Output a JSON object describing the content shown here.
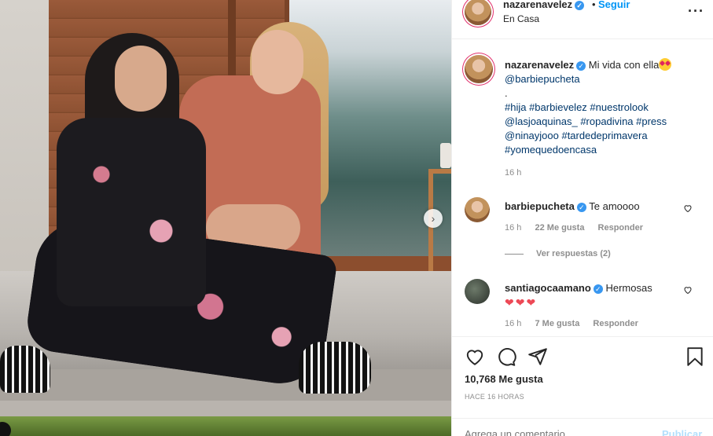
{
  "post": {
    "username": "nazarenavelez",
    "verified": true,
    "follow_label": "Seguir",
    "separator": "•",
    "location": "En Casa",
    "more_icon": "more-options-icon"
  },
  "caption": {
    "username": "nazarenavelez",
    "text": "Mi vida con ella",
    "mention": "@barbiepucheta",
    "dot": ".",
    "tags_line1": "#hija #barbievelez #nuestrolook",
    "tags_line2": "@lasjoaquinas_ #ropadivina #press",
    "tags_line3": "@ninayjooo #tardedeprimavera",
    "tags_line4": "#yomequedoencasa",
    "time": "16 h"
  },
  "comments": [
    {
      "username": "barbiepucheta",
      "text": "Te amoooo",
      "time": "16 h",
      "likes": "22 Me gusta",
      "reply": "Responder",
      "view_replies": "Ver respuestas (2)"
    },
    {
      "username": "santiagocaamano",
      "text": "Hermosas",
      "hearts": "❤❤❤",
      "time": "16 h",
      "likes": "7 Me gusta",
      "reply": "Responder"
    }
  ],
  "actions": {
    "like_icon": "heart-icon",
    "comment_icon": "comment-icon",
    "share_icon": "share-icon",
    "save_icon": "bookmark-icon",
    "likes_count": "10,768 Me gusta",
    "time_ago": "HACE 16 HORAS"
  },
  "composer": {
    "placeholder": "Agrega un comentario...",
    "publish_label": "Publicar"
  },
  "colors": {
    "link": "#00376b",
    "follow": "#0095f6",
    "muted": "#8e8e8e",
    "heart": "#ed4956",
    "verified": "#3897f0"
  }
}
